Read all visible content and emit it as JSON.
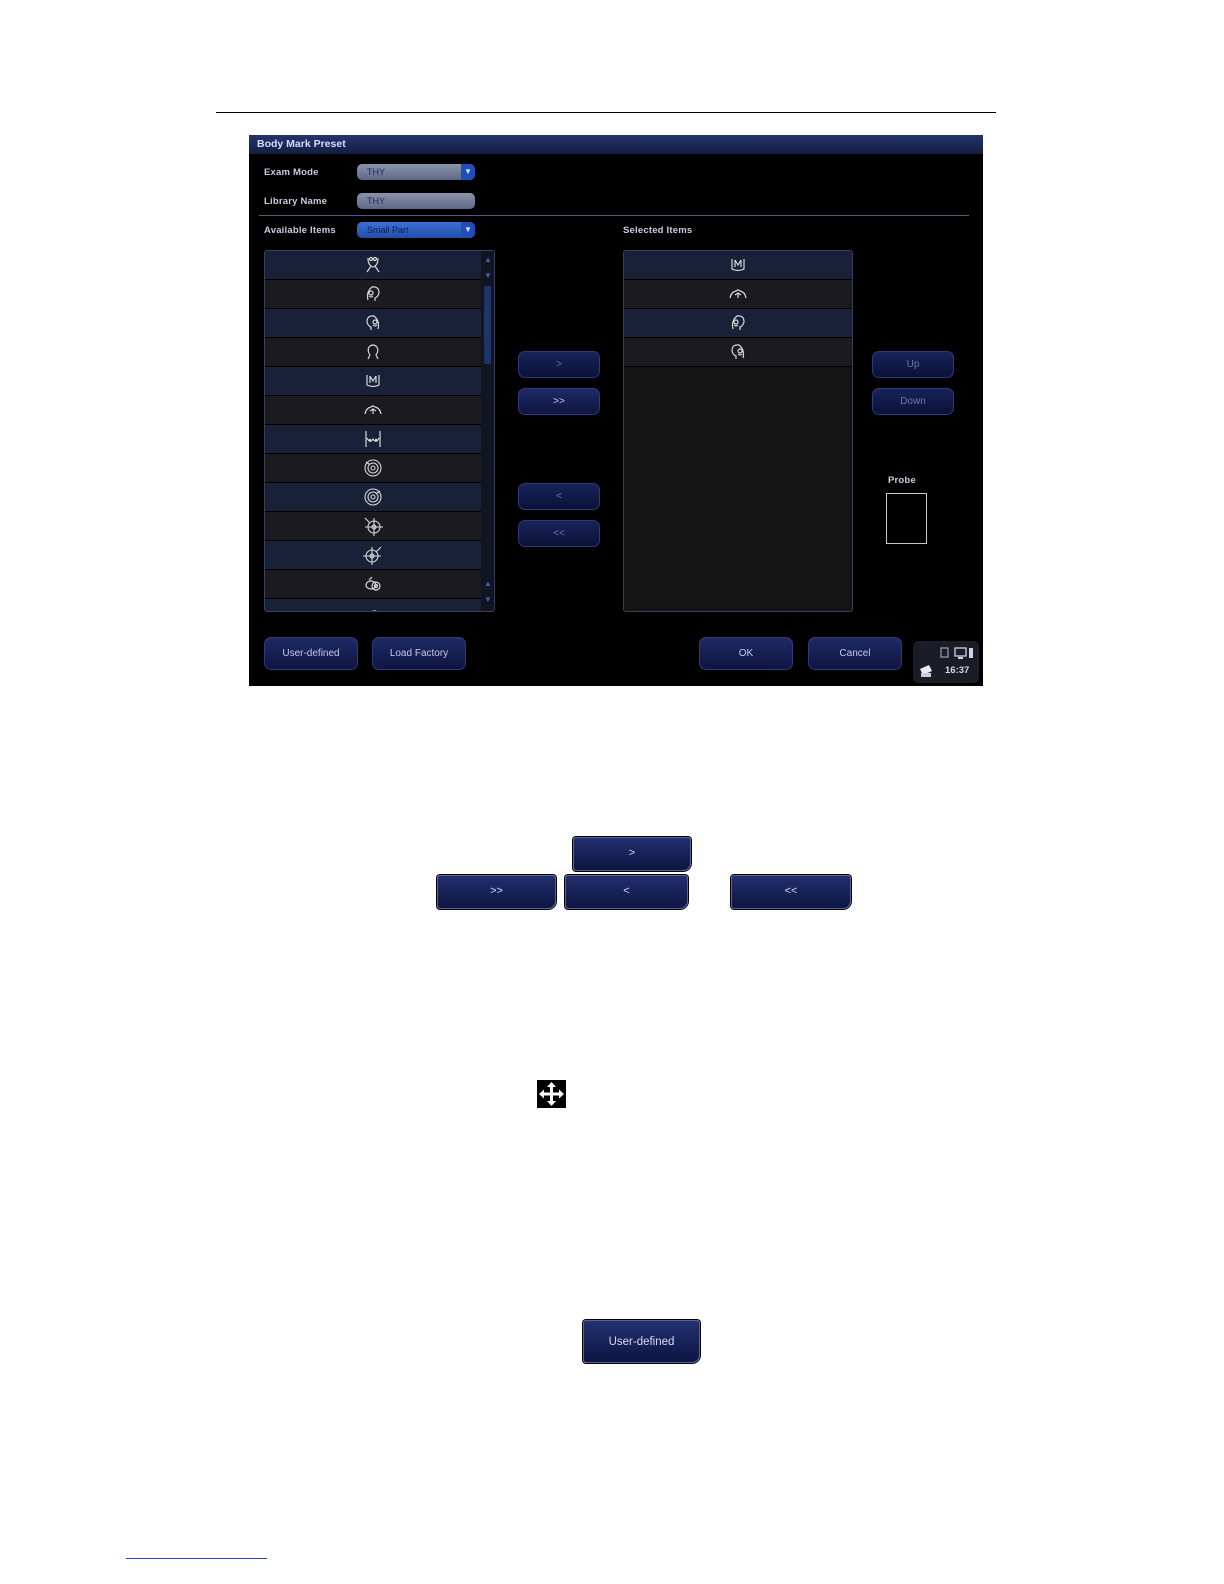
{
  "dialog": {
    "title": "Body Mark Preset",
    "exam_mode_label": "Exam Mode",
    "exam_mode_value": "THY",
    "library_name_label": "Library Name",
    "library_name_value": "THY",
    "available_items_label": "Available Items",
    "available_items_value": "Small Part",
    "selected_items_label": "Selected Items",
    "probe_label": "Probe",
    "buttons": {
      "add": ">",
      "add_all": ">>",
      "remove": "<",
      "remove_all": "<<",
      "up": "Up",
      "down": "Down",
      "user_defined": "User-defined",
      "load_factory": "Load Factory",
      "ok": "OK",
      "cancel": "Cancel"
    },
    "tray_time": "16:37"
  },
  "available_items": [
    "neck-front",
    "head-side-right",
    "head-side-left",
    "head-outline",
    "thyroid",
    "shoulders",
    "breasts",
    "breast-target-right",
    "breast-target-left",
    "breast-quadrant-right",
    "breast-quadrant-left",
    "testis",
    "testis-side"
  ],
  "selected_items": [
    "thyroid",
    "shoulders",
    "head-side-right",
    "head-side-left"
  ],
  "colors": {
    "dialog_bg": "#000000",
    "title_bar": "#1c2a5a",
    "button": "#16205a",
    "row_blue": "#182138",
    "row_dark": "#1b1b1f"
  },
  "illustration": {
    "add": ">",
    "add_all": ">>",
    "remove": "<",
    "remove_all": "<<",
    "move_icon": "move-arrows-icon",
    "user_defined": "User-defined"
  }
}
